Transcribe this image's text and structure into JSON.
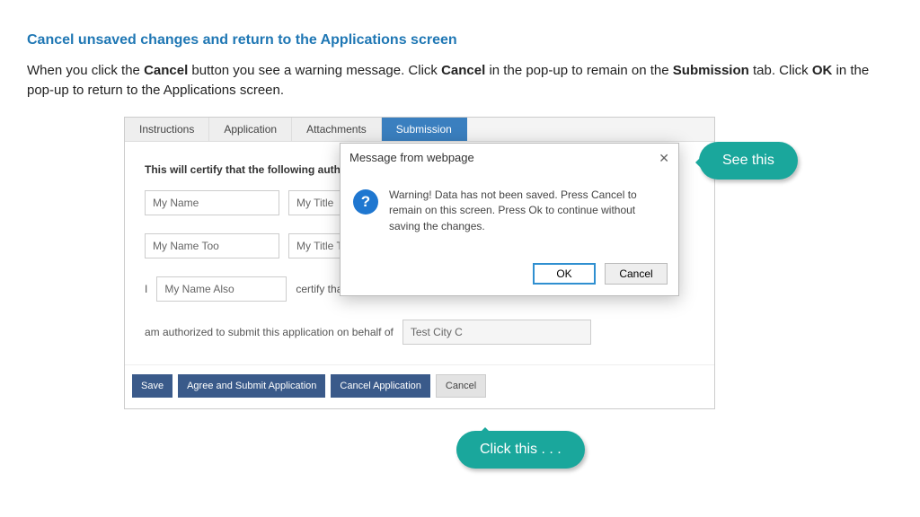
{
  "heading": "Cancel unsaved changes and return to the Applications screen",
  "intro": {
    "p1a": "When you click the ",
    "b1": "Cancel",
    "p1b": " button you see a warning message. Click ",
    "b2": "Cancel",
    "p1c": " in the pop-up to remain on the ",
    "b3": "Submission",
    "p1d": " tab. Click ",
    "b4": "OK",
    "p1e": " in the pop-up to return to the Applications screen."
  },
  "tabs": {
    "t0": "Instructions",
    "t1": "Application",
    "t2": "Attachments",
    "t3": "Submission"
  },
  "panel": {
    "certify_head": "This will certify that the following authoritie",
    "name1": "My Name",
    "title1": "My Title",
    "name2": "My Name Too",
    "title2": "My Title To",
    "i_leading": "I",
    "name3": "My Name Also",
    "certify_that": "certify that I",
    "auth_line": "am authorized to submit this application on behalf of",
    "org": "Test City C"
  },
  "buttons": {
    "save": "Save",
    "agree": "Agree and Submit Application",
    "cancel_app": "Cancel Application",
    "cancel": "Cancel"
  },
  "modal": {
    "title": "Message from webpage",
    "body": "Warning! Data has not been saved. Press Cancel to remain on this screen. Press Ok to continue without saving the changes.",
    "ok": "OK",
    "cancel": "Cancel",
    "qmark": "?"
  },
  "callouts": {
    "see": "See this",
    "click": "Click this . . ."
  }
}
